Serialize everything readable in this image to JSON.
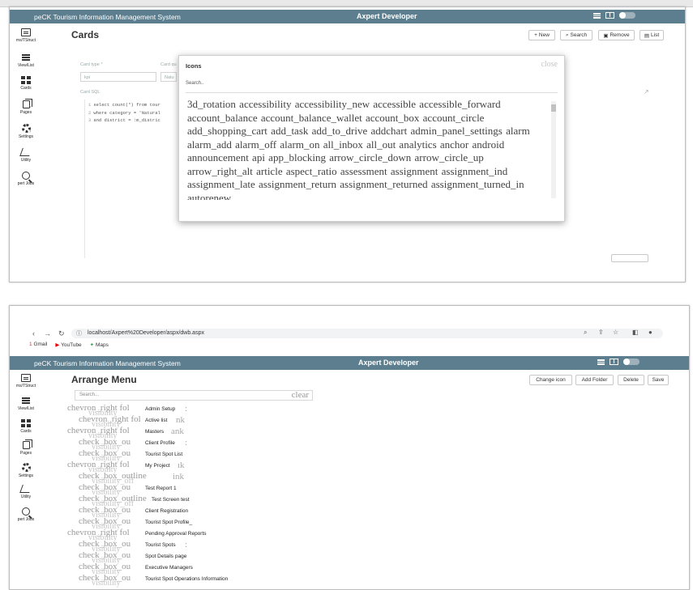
{
  "top_panel": {
    "app_title": "peCK Tourism Information Management System",
    "brand": "Axpert Developer",
    "page_title": "Cards",
    "toolbar": {
      "new": "New",
      "search": "Search",
      "remove": "Remove",
      "list": "List"
    },
    "sidebar": [
      "ms/TStruct",
      "View/List",
      "Cards",
      "Pages",
      "Settings",
      "Utility",
      "pert Jobs"
    ],
    "form": {
      "card_type_label": "Card type *",
      "card_type_value": "kpi",
      "card_q_label": "Card qu",
      "card_q_value": "Natu",
      "card_sql_label": "Card SQL"
    },
    "sql": [
      {
        "n": "1",
        "text": "select count(*) from tour"
      },
      {
        "n": "2",
        "text": "where category = 'Natural"
      },
      {
        "n": "3",
        "text": "and district = :m_distric"
      }
    ],
    "modal": {
      "title": "Icons",
      "close": "close",
      "search_placeholder": "Search..",
      "icons_text": "3d_rotation accessibility accessibility_new accessible accessible_forward account_balance account_balance_wallet account_box account_circle add_shopping_cart add_task add_to_drive addchart admin_panel_settings alarm alarm_add alarm_off alarm_on all_inbox all_out analytics anchor android announcement api app_blocking arrow_circle_down arrow_circle_up arrow_right_alt article aspect_ratio assessment assignment assignment_ind assignment_late assignment_return assignment_returned assignment_turned_in autorenew"
    }
  },
  "bottom_panel": {
    "address": "localhost/Axpert%20Developer/aspx/dwb.aspx",
    "bookmarks": [
      "Gmail",
      "YouTube",
      "Maps"
    ],
    "app_title": "peCK Tourism Information Management System",
    "brand": "Axpert Developer",
    "page_title": "Arrange Menu",
    "toolbar": {
      "change_icon": "Change icon",
      "add_folder": "Add Folder",
      "delete": "Delete",
      "save": "Save"
    },
    "search_placeholder": "Search...",
    "search_clear": "clear",
    "sidebar": [
      "ms/TStruct",
      "View/List",
      "Cards",
      "Pages",
      "Settings",
      "Utility",
      "pert Jobs"
    ],
    "rows": [
      {
        "ligs": "chevron_right fol",
        "lig2": "visibility",
        "label": "Admin Setup",
        "trail": ":"
      },
      {
        "ligs": "chevron_right fol",
        "lig2": "visibility",
        "label": "Active list",
        "trail": "nk"
      },
      {
        "ligs": "chevron_right fol",
        "lig2": "visibility",
        "label": "Masters",
        "trail": "ank"
      },
      {
        "ligs": "check_box_ou",
        "lig2": "visibility",
        "label": "Client Profile",
        "trail": ":"
      },
      {
        "ligs": "check_box_ou",
        "lig2": "visibility",
        "label": "Tourist Spot List",
        "trail": ""
      },
      {
        "ligs": "chevron_right fol",
        "lig2": "visibility",
        "label": "My Project",
        "trail": "ık"
      },
      {
        "ligs": "check_box_outline",
        "lig2": "visibility_off",
        "label": "",
        "trail": "ink"
      },
      {
        "ligs": "check_box_ou",
        "lig2": "visibility",
        "label": "Test Report 1",
        "trail": ""
      },
      {
        "ligs": "check_box_outline",
        "lig2": "visibility_off",
        "label": "Test Screen test",
        "trail": ""
      },
      {
        "ligs": "check_box_ou",
        "lig2": "visibility",
        "label": "Client Registration",
        "trail": ""
      },
      {
        "ligs": "check_box_ou",
        "lig2": "visibility",
        "label": "Tourist Spot Profile_",
        "trail": ""
      },
      {
        "ligs": "chevron_right fol",
        "lig2": "visibility",
        "label": "Pending Approval Reports",
        "trail": ""
      },
      {
        "ligs": "check_box_ou",
        "lig2": "visibility",
        "label": "Tourist Spots",
        "trail": ":"
      },
      {
        "ligs": "check_box_ou",
        "lig2": "visibility",
        "label": "Spot Details page",
        "trail": ""
      },
      {
        "ligs": "check_box_ou",
        "lig2": "visibility",
        "label": "Executive Managers",
        "trail": ""
      },
      {
        "ligs": "check_box_ou",
        "lig2": "visibility",
        "label": "Tourist Spot Operations Information",
        "trail": ""
      }
    ]
  }
}
